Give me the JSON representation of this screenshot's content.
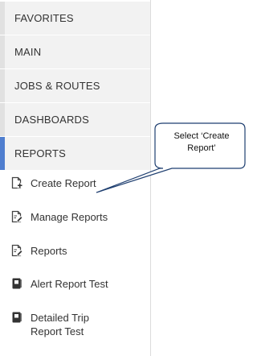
{
  "sidebar": {
    "sections": [
      {
        "label": "FAVORITES"
      },
      {
        "label": "MAIN"
      },
      {
        "label": "JOBS & ROUTES"
      },
      {
        "label": "DASHBOARDS"
      },
      {
        "label": "REPORTS"
      }
    ],
    "items": [
      {
        "label": "Create Report",
        "icon": "create-report-icon"
      },
      {
        "label": "Manage Reports",
        "icon": "manage-reports-icon"
      },
      {
        "label": "Reports",
        "icon": "reports-icon"
      },
      {
        "label": "Alert Report Test",
        "icon": "saved-report-icon"
      },
      {
        "label_line1": "Detailed Trip",
        "label_line2": "Report Test",
        "icon": "saved-report-icon"
      }
    ]
  },
  "callout": {
    "line1": "Select ‘Create",
    "line2": "Report’"
  },
  "colors": {
    "active_accent": "#4f7ecf",
    "section_bg": "#f2f2f2",
    "text": "#333333"
  }
}
